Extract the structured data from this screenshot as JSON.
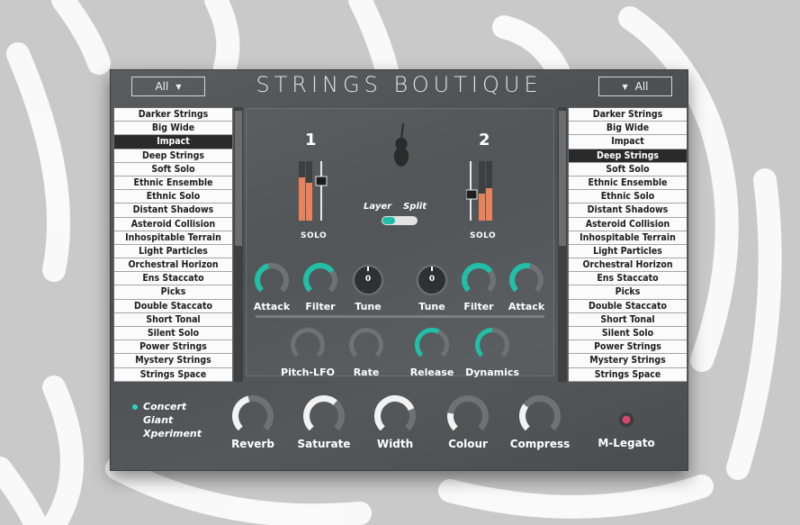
{
  "header": {
    "title": "STRINGS BOUTIQUE",
    "left_filter": "All",
    "right_filter": "All"
  },
  "left_list": {
    "selected": "Impact",
    "items": [
      "Darker Strings",
      "Big Wide",
      "Impact",
      "Deep Strings",
      "Soft Solo",
      "Ethnic Ensemble",
      "Ethnic Solo",
      "Distant Shadows",
      "Asteroid Collision",
      "Inhospitable Terrain",
      "Light Particles",
      "Orchestral Horizon",
      "Ens Staccato",
      "Picks",
      "Double Staccato",
      "Short Tonal",
      "Silent Solo",
      "Power Strings",
      "Mystery Strings",
      "Strings Space"
    ]
  },
  "right_list": {
    "selected": "Deep Strings",
    "items": [
      "Darker Strings",
      "Big Wide",
      "Impact",
      "Deep Strings",
      "Soft Solo",
      "Ethnic Ensemble",
      "Ethnic Solo",
      "Distant Shadows",
      "Asteroid Collision",
      "Inhospitable Terrain",
      "Light Particles",
      "Orchestral Horizon",
      "Ens Staccato",
      "Picks",
      "Double Staccato",
      "Short Tonal",
      "Silent Solo",
      "Power Strings",
      "Mystery Strings",
      "Strings Space"
    ]
  },
  "layers": {
    "layer1_number": "1",
    "layer2_number": "2",
    "solo1": "SOLO",
    "solo2": "SOLO",
    "layer_label": "Layer",
    "split_label": "Split",
    "mode_selected": "Layer"
  },
  "knobs_top": {
    "left": [
      {
        "label": "Attack",
        "value": 0.45
      },
      {
        "label": "Filter",
        "value": 0.7
      },
      {
        "label": "Tune",
        "display": "0"
      }
    ],
    "right": [
      {
        "label": "Tune",
        "display": "0"
      },
      {
        "label": "Filter",
        "value": 0.7
      },
      {
        "label": "Attack",
        "value": 0.55
      }
    ]
  },
  "knobs_mid": [
    {
      "label": "Pitch-LFO",
      "value": 0.0
    },
    {
      "label": "Rate",
      "value": 0.0
    },
    {
      "label": "Release",
      "value": 0.6
    },
    {
      "label": "Dynamics",
      "value": 0.5
    }
  ],
  "bottom": {
    "modes": [
      "Concert",
      "Giant",
      "Xperiment"
    ],
    "active_mode": "Concert",
    "knobs": [
      {
        "label": "Reverb",
        "value": 0.45
      },
      {
        "label": "Saturate",
        "value": 0.65
      },
      {
        "label": "Width",
        "value": 0.75
      },
      {
        "label": "Colour",
        "value": 0.2
      },
      {
        "label": "Compress",
        "value": 0.3
      }
    ],
    "legato_label": "M-Legato"
  },
  "colors": {
    "accent": "#1fbfa8",
    "meter": "#e8825b",
    "knob_track": "#6f7274",
    "list_selected": "#2a2a2a"
  }
}
